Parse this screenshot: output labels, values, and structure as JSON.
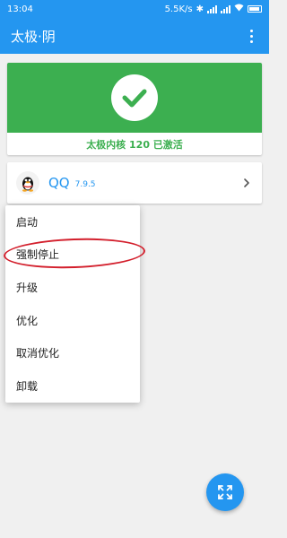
{
  "statusbar": {
    "time": "13:04",
    "net_speed": "5.5K/s"
  },
  "appbar": {
    "title": "太极·阴"
  },
  "status_card": {
    "text": "太极内核 120 已激活",
    "accent": "#3caf50"
  },
  "app": {
    "name": "QQ",
    "version": "7.9.5"
  },
  "menu": {
    "items": [
      "启动",
      "强制停止",
      "升级",
      "优化",
      "取消优化",
      "卸载"
    ]
  },
  "colors": {
    "primary": "#2496f0",
    "success": "#3caf50",
    "highlight": "#d31f2c"
  }
}
